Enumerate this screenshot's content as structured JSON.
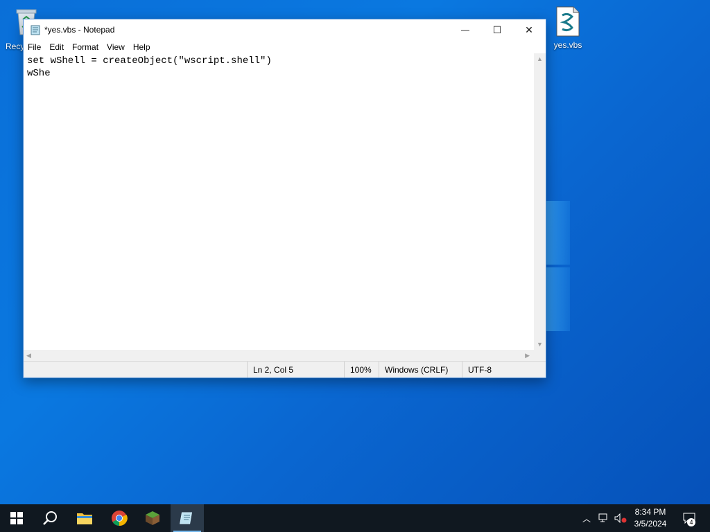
{
  "desktop": {
    "icons": [
      {
        "label": "Recy"
      },
      {
        "label": "yes.vbs"
      }
    ]
  },
  "notepad": {
    "title": "*yes.vbs - Notepad",
    "menu": [
      "File",
      "Edit",
      "Format",
      "View",
      "Help"
    ],
    "content_lines": [
      "set wShell = createObject(\"wscript.shell\")",
      "wShe"
    ],
    "status": {
      "position": "Ln 2, Col 5",
      "zoom": "100%",
      "line_ending": "Windows (CRLF)",
      "encoding": "UTF-8"
    },
    "window_buttons": {
      "minimize": "—",
      "maximize": "☐",
      "close": "✕"
    }
  },
  "taskbar": {
    "items": [
      "start-icon",
      "search-icon",
      "file-explorer-icon",
      "chrome-icon",
      "minecraft-icon",
      "notepad-icon"
    ],
    "clock": {
      "time": "8:34 PM",
      "date": "3/5/2024"
    },
    "notification_count": "4",
    "colors": {
      "taskbar": "#101820",
      "accent": "#76b9ed"
    }
  }
}
